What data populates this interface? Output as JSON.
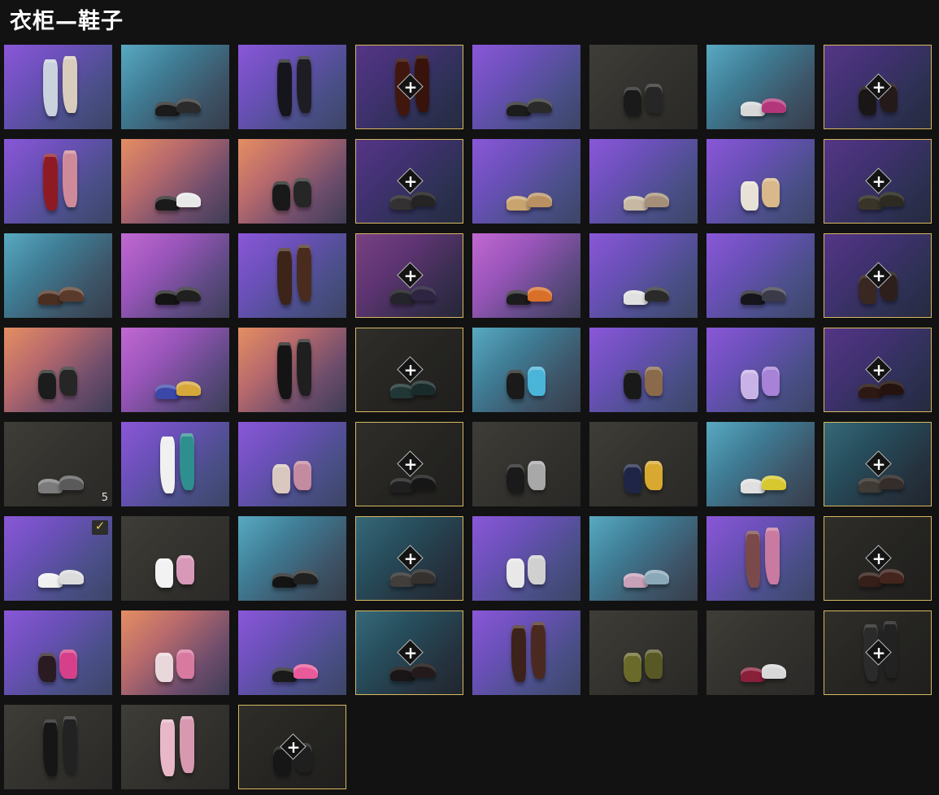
{
  "header": {
    "title": "衣柜—鞋子"
  },
  "colors": {
    "slot_border": "#d7b760",
    "checkmark": "#e6c45a",
    "page_background": "#121212"
  },
  "tiles": [
    {
      "bg": "purple",
      "slot": false,
      "shoe": "tall",
      "c1": "#c9d2dd",
      "c2": "#d8cdbd"
    },
    {
      "bg": "teal",
      "slot": false,
      "shoe": "low",
      "c1": "#1b1b1b",
      "c2": "#2b2b2b"
    },
    {
      "bg": "purple",
      "slot": false,
      "shoe": "tall",
      "c1": "#15151b",
      "c2": "#1d1d23"
    },
    {
      "bg": "purple",
      "slot": true,
      "shoe": "tall",
      "c1": "#6a2416",
      "c2": "#5a1f13"
    },
    {
      "bg": "purple",
      "slot": false,
      "shoe": "low",
      "c1": "#1c1c1c",
      "c2": "#2a2a2a"
    },
    {
      "bg": "gray",
      "slot": false,
      "shoe": "mid",
      "c1": "#1a1a1a",
      "c2": "#262626"
    },
    {
      "bg": "teal",
      "slot": false,
      "shoe": "low",
      "c1": "#d8d8d8",
      "c2": "#b3367a"
    },
    {
      "bg": "purple",
      "slot": true,
      "shoe": "mid",
      "c1": "#2c2424",
      "c2": "#3b2a2a"
    },
    {
      "bg": "purple",
      "slot": false,
      "shoe": "tall",
      "c1": "#8e1b24",
      "c2": "#cf8a9a"
    },
    {
      "bg": "orange",
      "slot": false,
      "shoe": "low",
      "c1": "#1a1a1a",
      "c2": "#e8e8e8"
    },
    {
      "bg": "orange",
      "slot": false,
      "shoe": "mid",
      "c1": "#191919",
      "c2": "#262626"
    },
    {
      "bg": "purple",
      "slot": true,
      "shoe": "low",
      "c1": "#555052",
      "c2": "#3d3a3b"
    },
    {
      "bg": "purple",
      "slot": false,
      "shoe": "low",
      "c1": "#c9a46e",
      "c2": "#b89062"
    },
    {
      "bg": "purple",
      "slot": false,
      "shoe": "low",
      "c1": "#c6b8a3",
      "c2": "#a58f78"
    },
    {
      "bg": "purple",
      "slot": false,
      "shoe": "mid",
      "c1": "#e8e2d6",
      "c2": "#d9b88a"
    },
    {
      "bg": "purple",
      "slot": true,
      "shoe": "low",
      "c1": "#5b5541",
      "c2": "#4a4636"
    },
    {
      "bg": "teal",
      "slot": false,
      "shoe": "low",
      "c1": "#4b2e22",
      "c2": "#5a3a2a"
    },
    {
      "bg": "pink",
      "slot": false,
      "shoe": "low",
      "c1": "#141414",
      "c2": "#202020"
    },
    {
      "bg": "purple",
      "slot": false,
      "shoe": "tall",
      "c1": "#3c2418",
      "c2": "#4a2c1e"
    },
    {
      "bg": "pink",
      "slot": true,
      "shoe": "low",
      "c1": "#3b3b45",
      "c2": "#4a3d6a"
    },
    {
      "bg": "pink",
      "slot": false,
      "shoe": "low",
      "c1": "#1b1b1b",
      "c2": "#d8702a"
    },
    {
      "bg": "purple",
      "slot": false,
      "shoe": "low",
      "c1": "#e0e0e0",
      "c2": "#2a2a2a"
    },
    {
      "bg": "purple",
      "slot": false,
      "shoe": "low",
      "c1": "#15151b",
      "c2": "#3a3a48"
    },
    {
      "bg": "purple",
      "slot": true,
      "shoe": "mid",
      "c1": "#5d4038",
      "c2": "#4a332d"
    },
    {
      "bg": "orange",
      "slot": false,
      "shoe": "mid",
      "c1": "#1c1c1c",
      "c2": "#262626"
    },
    {
      "bg": "pink",
      "slot": false,
      "shoe": "low",
      "c1": "#3c48a8",
      "c2": "#d6a83a"
    },
    {
      "bg": "orange",
      "slot": false,
      "shoe": "tall",
      "c1": "#141414",
      "c2": "#1f1f1f"
    },
    {
      "bg": "gray",
      "slot": true,
      "shoe": "low",
      "c1": "#2c4a48",
      "c2": "#223a38"
    },
    {
      "bg": "teal",
      "slot": false,
      "shoe": "mid",
      "c1": "#1a1a1a",
      "c2": "#4ab5d8"
    },
    {
      "bg": "purple",
      "slot": false,
      "shoe": "mid",
      "c1": "#191919",
      "c2": "#8a6a4a"
    },
    {
      "bg": "purple",
      "slot": false,
      "shoe": "mid",
      "c1": "#c9b3e6",
      "c2": "#a782d6"
    },
    {
      "bg": "purple",
      "slot": true,
      "shoe": "low",
      "c1": "#4a2820",
      "c2": "#3a2019"
    },
    {
      "bg": "gray",
      "slot": false,
      "shoe": "low",
      "c1": "#7b7b7b",
      "c2": "#5a5a5a",
      "count": "5"
    },
    {
      "bg": "purple",
      "slot": false,
      "shoe": "tall",
      "c1": "#f0f0f0",
      "c2": "#2f8f8f"
    },
    {
      "bg": "purple",
      "slot": false,
      "shoe": "mid",
      "c1": "#d8c8c0",
      "c2": "#c48aa0"
    },
    {
      "bg": "gray",
      "slot": true,
      "shoe": "low",
      "c1": "#2a2a2a",
      "c2": "#1e1e1e"
    },
    {
      "bg": "gray",
      "slot": false,
      "shoe": "mid",
      "c1": "#1a1a1a",
      "c2": "#a8a8a8"
    },
    {
      "bg": "gray",
      "slot": false,
      "shoe": "mid",
      "c1": "#1e2546",
      "c2": "#d8a830"
    },
    {
      "bg": "teal",
      "slot": false,
      "shoe": "low",
      "c1": "#e0e0e0",
      "c2": "#d8c830"
    },
    {
      "bg": "teal",
      "slot": true,
      "shoe": "low",
      "c1": "#6a6058",
      "c2": "#544a44"
    },
    {
      "bg": "purple",
      "slot": false,
      "shoe": "low",
      "c1": "#f0f0f0",
      "c2": "#dcdcdc",
      "equipped": true
    },
    {
      "bg": "gray",
      "slot": false,
      "shoe": "mid",
      "c1": "#f2f2f2",
      "c2": "#d898b8"
    },
    {
      "bg": "teal",
      "slot": false,
      "shoe": "low",
      "c1": "#141414",
      "c2": "#202020"
    },
    {
      "bg": "teal",
      "slot": true,
      "shoe": "low",
      "c1": "#6a6560",
      "c2": "#55504c"
    },
    {
      "bg": "purple",
      "slot": false,
      "shoe": "mid",
      "c1": "#e8e8e8",
      "c2": "#d0d0d0"
    },
    {
      "bg": "teal",
      "slot": false,
      "shoe": "low",
      "c1": "#c8a0b8",
      "c2": "#8aa8b8"
    },
    {
      "bg": "purple",
      "slot": false,
      "shoe": "tall",
      "c1": "#7a4a4a",
      "c2": "#c87aa0"
    },
    {
      "bg": "gray",
      "slot": true,
      "shoe": "low",
      "c1": "#4a2a22",
      "c2": "#5a3228"
    },
    {
      "bg": "purple",
      "slot": false,
      "shoe": "mid",
      "c1": "#2a1a22",
      "c2": "#d6408a"
    },
    {
      "bg": "orange",
      "slot": false,
      "shoe": "mid",
      "c1": "#e8d8dc",
      "c2": "#d87aa0"
    },
    {
      "bg": "purple",
      "slot": false,
      "shoe": "low",
      "c1": "#1a1a1a",
      "c2": "#e85a9a"
    },
    {
      "bg": "teal",
      "slot": true,
      "shoe": "low",
      "c1": "#2a2224",
      "c2": "#3a2a2c"
    },
    {
      "bg": "purple",
      "slot": false,
      "shoe": "tall",
      "c1": "#3c221a",
      "c2": "#4a2a20"
    },
    {
      "bg": "gray",
      "slot": false,
      "shoe": "mid",
      "c1": "#6a6a2a",
      "c2": "#585824"
    },
    {
      "bg": "gray",
      "slot": false,
      "shoe": "low",
      "c1": "#8a1f3a",
      "c2": "#d8d8d8"
    },
    {
      "bg": "gray",
      "slot": true,
      "shoe": "tall",
      "c1": "#3a3a3a",
      "c2": "#2e2e2e"
    },
    {
      "bg": "gray",
      "slot": false,
      "shoe": "tall",
      "c1": "#161616",
      "c2": "#222222"
    },
    {
      "bg": "gray",
      "slot": false,
      "shoe": "tall",
      "c1": "#e8b8c8",
      "c2": "#d898b0"
    },
    {
      "bg": "gray",
      "slot": true,
      "shoe": "mid",
      "c1": "#1e1e1e",
      "c2": "#2a2a2a"
    }
  ]
}
